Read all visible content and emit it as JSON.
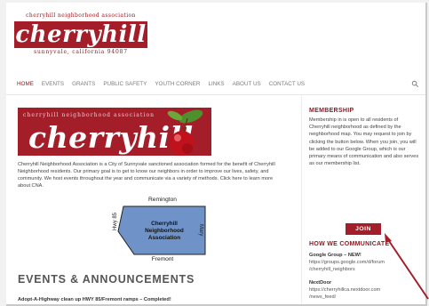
{
  "header": {
    "logo_top": "cherryhill neighborhood association",
    "logo_word": "cherryhill",
    "logo_bottom": "sunnyvale, california 94087"
  },
  "nav": {
    "items": [
      "HOME",
      "EVENTS",
      "GRANTS",
      "PUBLIC SAFETY",
      "YOUTH CORNER",
      "LINKS",
      "ABOUT US",
      "CONTACT US"
    ],
    "active": "HOME",
    "search_icon": "search-icon"
  },
  "main": {
    "banner": {
      "top_text": "cherryhill neighborhood association",
      "word": "cherryhill",
      "image": "cherry-image"
    },
    "intro": "Cherryhill Neighborhood Association is a City of Sunnyvale sanctioned association formed for the benefit of Cherryhill Neighborhood residents. Our primary goal is to get to know our neighbors in order to improve our lives, safety, and community. We host events throughout the year and communicate via a variety of methods. Click here to learn more about CNA.",
    "map": {
      "top": "Remington",
      "bottom": "Fremont",
      "left": "Hwy 85",
      "right": "Mary",
      "name_line1": "Cherryhill",
      "name_line2": "Neighborhood",
      "name_line3": "Association"
    },
    "events_title": "EVENTS & ANNOUNCEMENTS",
    "events_first": "Adopt-A-Highway clean up HWY 85/Fremont ramps – Completed!"
  },
  "sidebar": {
    "membership_title": "MEMBERSHIP",
    "membership_text": "Membership in is open to all residents of Cherryhill neighborhood as defined by the neighborhood map. You may request to join by clicking the button below. When you join, you will be added to our Google Group, which is our primary means of communication and also serves as our membership list.",
    "join_label": "JOIN",
    "communicate_title": "HOW WE COMMUNICATE",
    "channels": [
      {
        "name": "Google Group – NEW!",
        "url_line1": "https://groups.google.com/d/forum",
        "url_line2": "/cherryhill_neighbors"
      },
      {
        "name": "NextDoor",
        "url_line1": "https://cherryhillca.nextdoor.com",
        "url_line2": "/news_feed/"
      }
    ]
  },
  "colors": {
    "brand_red": "#a41e2a",
    "dark_red": "#8e1b21",
    "map_blue": "#6f93c8"
  }
}
